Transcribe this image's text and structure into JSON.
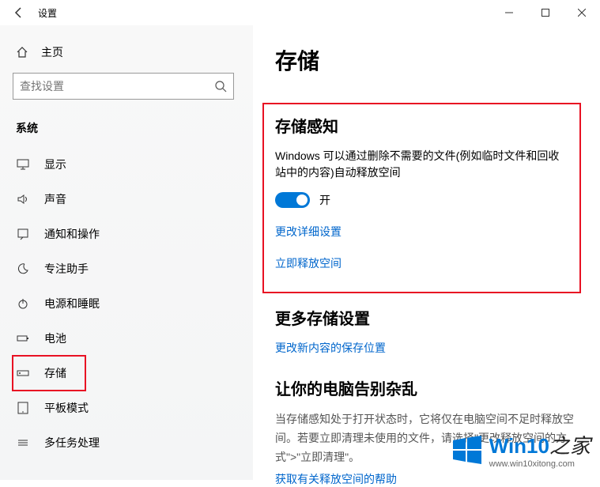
{
  "window": {
    "title": "设置"
  },
  "sidebar": {
    "home_label": "主页",
    "search_placeholder": "查找设置",
    "category": "系统",
    "items": [
      {
        "label": "显示"
      },
      {
        "label": "声音"
      },
      {
        "label": "通知和操作"
      },
      {
        "label": "专注助手"
      },
      {
        "label": "电源和睡眠"
      },
      {
        "label": "电池"
      },
      {
        "label": "存储"
      },
      {
        "label": "平板模式"
      },
      {
        "label": "多任务处理"
      }
    ]
  },
  "main": {
    "title": "存储",
    "sense": {
      "heading": "存储感知",
      "description": "Windows 可以通过删除不需要的文件(例如临时文件和回收站中的内容)自动释放空间",
      "toggle_state": "开",
      "link_settings": "更改详细设置",
      "link_free": "立即释放空间"
    },
    "more": {
      "heading": "更多存储设置",
      "link_change": "更改新内容的保存位置"
    },
    "junk": {
      "heading": "让你的电脑告别杂乱",
      "description": "当存储感知处于打开状态时，它将仅在电脑空间不足时释放空间。若要立即清理未使用的文件，请选择\"更改释放空间的方式\">\"立即清理\"。",
      "link_help": "获取有关释放空间的帮助"
    }
  },
  "watermark": {
    "brand": "Win10",
    "suffix": "之家",
    "url": "www.win10xitong.com"
  }
}
